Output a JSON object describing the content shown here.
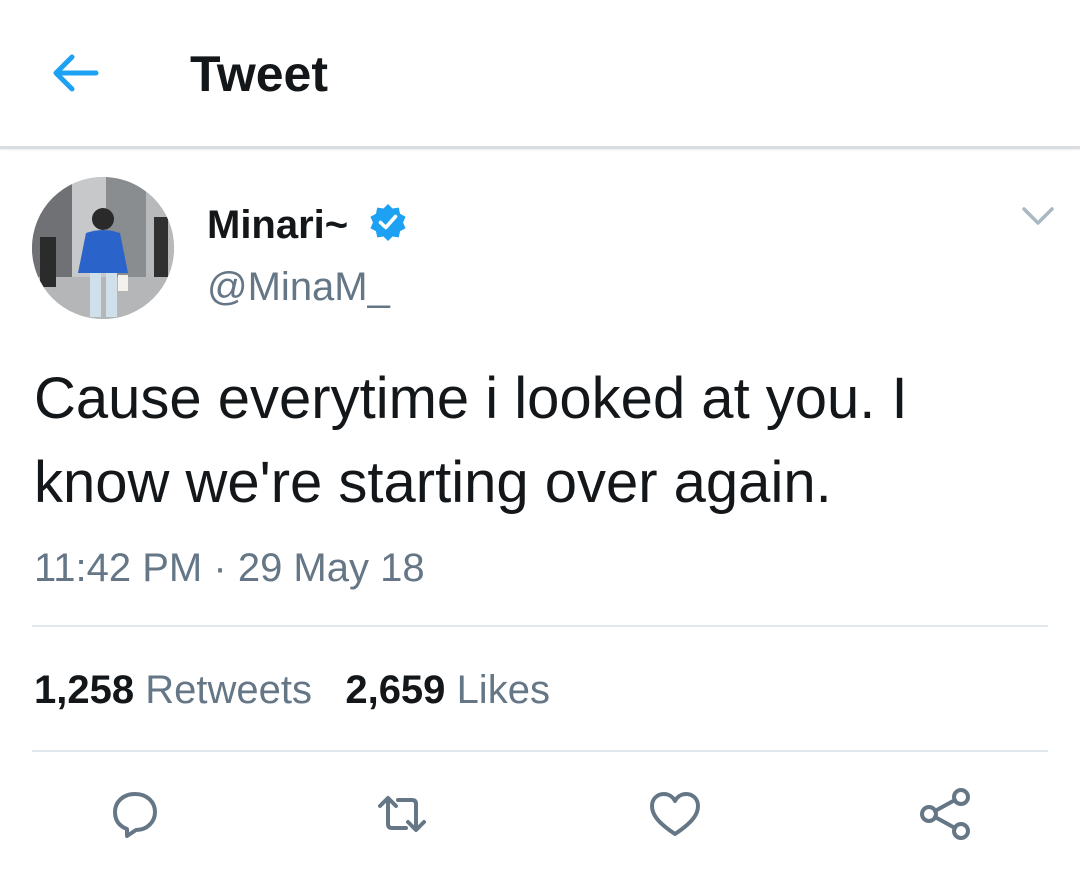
{
  "header": {
    "title": "Tweet",
    "back_icon": "arrow-left-icon"
  },
  "colors": {
    "accent": "#1da1f2",
    "text": "#14171a",
    "secondary": "#657786",
    "divider": "#e1e8ed"
  },
  "tweet": {
    "author": {
      "display_name": "Minari~",
      "handle": "@MinaM_",
      "verified": true
    },
    "text": "Cause everytime i looked at you. I know we're starting over again.",
    "time": "11:42 PM",
    "separator": "·",
    "date": "29 May 18",
    "stats": {
      "retweets_count": "1,258",
      "retweets_label": "Retweets",
      "likes_count": "2,659",
      "likes_label": "Likes"
    }
  },
  "actions": [
    {
      "icon": "reply-icon"
    },
    {
      "icon": "retweet-icon"
    },
    {
      "icon": "like-icon"
    },
    {
      "icon": "share-icon"
    }
  ]
}
